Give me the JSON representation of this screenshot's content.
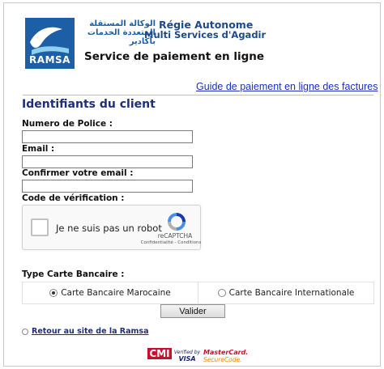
{
  "header": {
    "logo_text": "RAMSA",
    "arabic_name": "الوكالة المستقلة المتعددة الخدمات بأكادير",
    "org_line1": "Régie Autonome",
    "org_line2": "Multi Services d'Agadir",
    "service_title": "Service de paiement en ligne"
  },
  "guide_link": "Guide de paiement en ligne des factures",
  "form": {
    "section_title": "Identifiants du client",
    "police_label": "Numero de Police :",
    "police_value": "",
    "email_label": "Email :",
    "email_value": "",
    "confirm_email_label": "Confirmer votre email :",
    "confirm_email_value": "",
    "verification_label": "Code de vérification :"
  },
  "recaptcha": {
    "label": "Je ne suis pas un robot",
    "brand": "reCAPTCHA",
    "links": "Confidentialité - Conditions"
  },
  "card": {
    "title": "Type Carte Bancaire :",
    "options": [
      {
        "label": "Carte Bancaire Marocaine",
        "selected": true
      },
      {
        "label": "Carte Bancaire Internationale",
        "selected": false
      }
    ]
  },
  "submit_label": "Valider",
  "back_link": "Retour au site de la Ramsa",
  "badges": {
    "cmi": "CMI",
    "visa_line1": "Verified by",
    "visa_line2": "VISA",
    "mc_line1": "MasterCard.",
    "mc_line2": "SecureCode."
  },
  "colors": {
    "brand_blue": "#1d5fa6",
    "title_navy": "#1d2f7a",
    "link_blue": "#1b2fc7"
  }
}
